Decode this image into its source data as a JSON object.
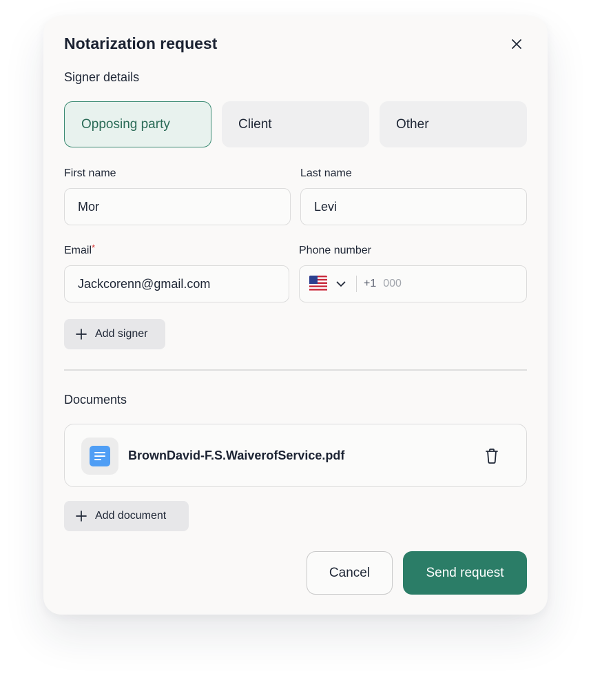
{
  "dialog": {
    "title": "Notarization request"
  },
  "signer": {
    "section_label": "Signer details",
    "types": [
      {
        "label": "Opposing party",
        "selected": true
      },
      {
        "label": "Client",
        "selected": false
      },
      {
        "label": "Other",
        "selected": false
      }
    ],
    "first_name": {
      "label": "First name",
      "value": "Mor"
    },
    "last_name": {
      "label": "Last name",
      "value": "Levi"
    },
    "email": {
      "label": "Email",
      "required_mark": "*",
      "value": "Jackcorenn@gmail.com"
    },
    "phone": {
      "label": "Phone number",
      "country_icon": "us-flag-icon",
      "country_code": "+1",
      "placeholder": "000"
    },
    "add_signer_label": "Add signer"
  },
  "documents": {
    "section_label": "Documents",
    "files": [
      {
        "name": "BrownDavid-F.S.WaiverofService.pdf",
        "icon": "document-icon"
      }
    ],
    "add_document_label": "Add document"
  },
  "footer": {
    "cancel_label": "Cancel",
    "send_label": "Send request"
  },
  "colors": {
    "accent": "#2b7d67",
    "selected_bg": "#e8f2ee",
    "selected_border": "#3a8a72",
    "required": "#d63a3a",
    "doc_icon": "#4f9ef5"
  }
}
